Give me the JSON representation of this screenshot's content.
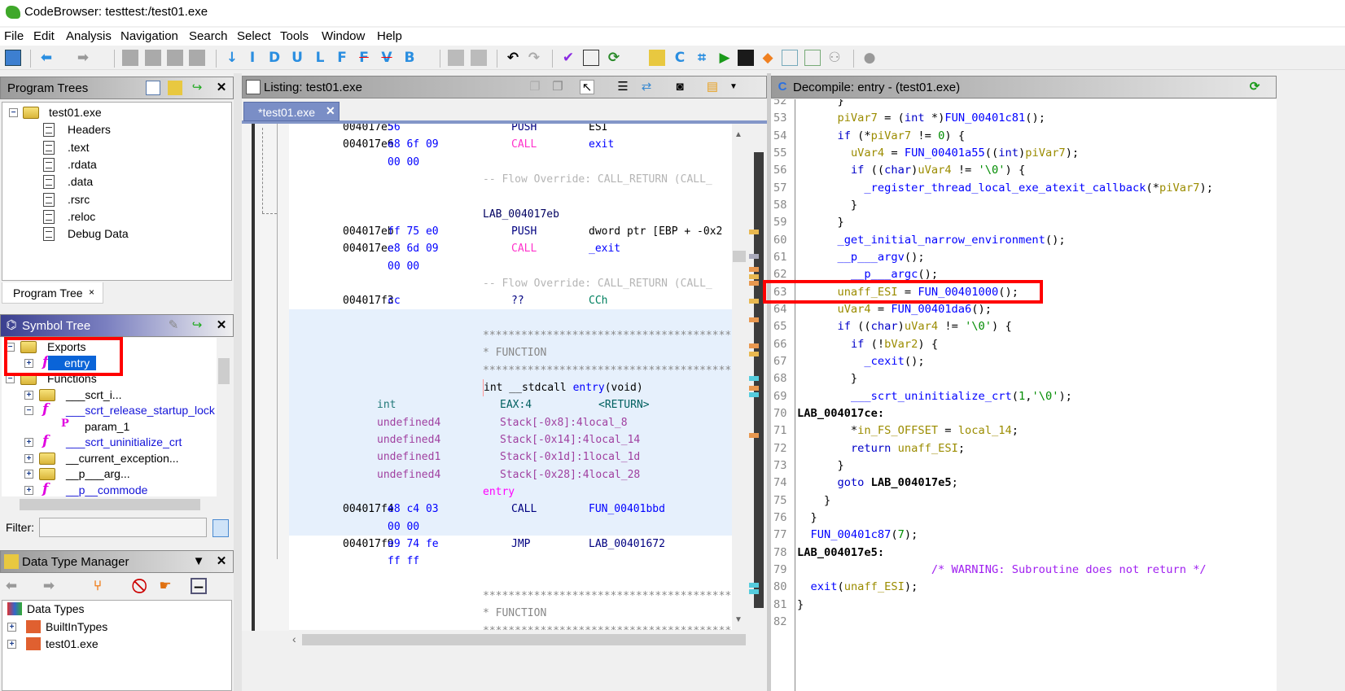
{
  "window": {
    "title": "CodeBrowser: testtest:/test01.exe"
  },
  "menu": [
    "File",
    "Edit",
    "Analysis",
    "Navigation",
    "Search",
    "Select",
    "Tools",
    "Window",
    "Help"
  ],
  "toolbar": {
    "letters": [
      "I",
      "D",
      "U",
      "L",
      "F",
      "F",
      "V",
      "B"
    ]
  },
  "program_trees": {
    "title": "Program Trees",
    "items": [
      {
        "label": "test01.exe",
        "depth": 0
      },
      {
        "label": "Headers",
        "depth": 1
      },
      {
        "label": ".text",
        "depth": 1
      },
      {
        "label": ".rdata",
        "depth": 1
      },
      {
        "label": ".data",
        "depth": 1
      },
      {
        "label": ".rsrc",
        "depth": 1
      },
      {
        "label": ".reloc",
        "depth": 1
      },
      {
        "label": "Debug Data",
        "depth": 1
      }
    ],
    "tab_label": "Program Tree",
    "tab_close": "×"
  },
  "symbol_tree": {
    "title": "Symbol Tree",
    "items": [
      {
        "label": "Exports",
        "depth": 0,
        "icon": "folder",
        "expander": "−"
      },
      {
        "label": "entry",
        "depth": 1,
        "icon": "function",
        "expander": "+",
        "selected": true
      },
      {
        "label": "Functions",
        "depth": 0,
        "icon": "folder",
        "expander": "−"
      },
      {
        "label": "___scrt_i...",
        "depth": 1,
        "icon": "folder",
        "expander": "+"
      },
      {
        "label": "___scrt_release_startup_lock",
        "depth": 1,
        "icon": "function",
        "expander": "−",
        "link": true
      },
      {
        "label": "param_1",
        "depth": 2,
        "icon": "parameter",
        "expander": ""
      },
      {
        "label": "___scrt_uninitialize_crt",
        "depth": 1,
        "icon": "function",
        "expander": "+",
        "link": true
      },
      {
        "label": "__current_exception...",
        "depth": 1,
        "icon": "folder",
        "expander": "+"
      },
      {
        "label": "__p___arg...",
        "depth": 1,
        "icon": "folder",
        "expander": "+"
      },
      {
        "label": "__p__commode",
        "depth": 1,
        "icon": "function",
        "expander": "+",
        "link": true
      }
    ],
    "filter_label": "Filter:",
    "filter_value": ""
  },
  "data_type_manager": {
    "title": "Data Type Manager",
    "items": [
      {
        "label": "Data Types",
        "depth": 0
      },
      {
        "label": "BuiltInTypes",
        "depth": 1
      },
      {
        "label": "test01.exe",
        "depth": 1
      }
    ]
  },
  "listing": {
    "title": "Listing:  test01.exe",
    "tab": "*test01.exe",
    "rows": [
      {
        "type": "ins",
        "addr": "004017e5",
        "bytes": "56",
        "mn": "PUSH",
        "op": "ESI"
      },
      {
        "type": "ins",
        "addr": "004017e6",
        "bytes": "e8 6f 09",
        "mn": "CALL",
        "op": "exit",
        "pink": true
      },
      {
        "type": "ins",
        "addr": "",
        "bytes": "00 00",
        "mn": "",
        "op": ""
      },
      {
        "type": "text",
        "cls": "gray",
        "text": "-- Flow Override: CALL_RETURN (CALL_"
      },
      {
        "type": "blank"
      },
      {
        "type": "text",
        "cls": "lab",
        "text": "LAB_004017eb"
      },
      {
        "type": "ins",
        "addr": "004017eb",
        "bytes": "ff 75 e0",
        "mn": "PUSH",
        "op": "dword ptr [EBP + -0x2"
      },
      {
        "type": "ins",
        "addr": "004017ee",
        "bytes": "e8 6d 09",
        "mn": "CALL",
        "op": "_exit",
        "pink": true
      },
      {
        "type": "ins",
        "addr": "",
        "bytes": "00 00",
        "mn": "",
        "op": ""
      },
      {
        "type": "text",
        "cls": "gray",
        "text": "-- Flow Override: CALL_RETURN (CALL_"
      },
      {
        "type": "ins",
        "addr": "004017f3",
        "bytes": "cc",
        "mn": "??",
        "op": "CCh",
        "opgreen": true
      },
      {
        "type": "blank",
        "hl": true
      },
      {
        "type": "text",
        "cls": "stars",
        "text": "******************************************",
        "hl": true
      },
      {
        "type": "text",
        "cls": "stars",
        "text": "*                             FUNCTION",
        "hl": true
      },
      {
        "type": "text",
        "cls": "stars",
        "text": "******************************************",
        "hl": true
      },
      {
        "type": "sig",
        "text1": "int __stdcall ",
        "text2": "entry",
        "text3": "(void)",
        "hl": true
      },
      {
        "type": "var",
        "dt": "int",
        "loc": "EAX:4",
        "name": "<RETURN>",
        "ret": true,
        "hl": true
      },
      {
        "type": "var",
        "dt": "undefined4",
        "loc": "Stack[-0x8]:4",
        "name": "local_8",
        "hl": true
      },
      {
        "type": "var",
        "dt": "undefined4",
        "loc": "Stack[-0x14]:4",
        "name": "local_14",
        "hl": true
      },
      {
        "type": "var",
        "dt": "undefined1",
        "loc": "Stack[-0x1d]:1",
        "name": "local_1d",
        "hl": true
      },
      {
        "type": "var",
        "dt": "undefined4",
        "loc": "Stack[-0x28]:4",
        "name": "local_28",
        "hl": true
      },
      {
        "type": "text",
        "cls": "entry",
        "text": "entry",
        "hl": true
      },
      {
        "type": "ins",
        "addr": "004017f4",
        "bytes": "e8 c4 03",
        "mn": "CALL",
        "op": "FUN_00401bbd",
        "hl": true
      },
      {
        "type": "ins",
        "addr": "",
        "bytes": "00 00",
        "mn": "",
        "op": "",
        "hl": true
      },
      {
        "type": "ins",
        "addr": "004017f9",
        "bytes": "e9 74 fe",
        "mn": "JMP",
        "op": "LAB_00401672"
      },
      {
        "type": "ins",
        "addr": "",
        "bytes": "ff ff",
        "mn": "",
        "op": ""
      },
      {
        "type": "blank"
      },
      {
        "type": "text",
        "cls": "stars",
        "text": "******************************************"
      },
      {
        "type": "text",
        "cls": "stars",
        "text": "*                             FUNCTION"
      },
      {
        "type": "text",
        "cls": "stars",
        "text": "******************************************"
      }
    ]
  },
  "decompile": {
    "title": "Decompile: entry -  (test01.exe)",
    "lines": [
      {
        "n": "52",
        "t": [
          [
            "      }",
            "p"
          ]
        ]
      },
      {
        "n": "53",
        "t": [
          [
            "      ",
            "p"
          ],
          [
            "piVar7",
            "v"
          ],
          [
            " = (",
            "p"
          ],
          [
            "int",
            "ty"
          ],
          [
            " *)",
            "p"
          ],
          [
            "FUN_00401c81",
            "f"
          ],
          [
            "();",
            "p"
          ]
        ]
      },
      {
        "n": "54",
        "t": [
          [
            "      ",
            "p"
          ],
          [
            "if",
            "k"
          ],
          [
            " (*",
            "p"
          ],
          [
            "piVar7",
            "v"
          ],
          [
            " != ",
            "p"
          ],
          [
            "0",
            "n"
          ],
          [
            ") {",
            "p"
          ]
        ]
      },
      {
        "n": "55",
        "t": [
          [
            "        ",
            "p"
          ],
          [
            "uVar4",
            "v"
          ],
          [
            " = ",
            "p"
          ],
          [
            "FUN_00401a55",
            "f"
          ],
          [
            "((",
            "p"
          ],
          [
            "int",
            "ty"
          ],
          [
            ")",
            "p"
          ],
          [
            "piVar7",
            "v"
          ],
          [
            ");",
            "p"
          ]
        ]
      },
      {
        "n": "56",
        "t": [
          [
            "        ",
            "p"
          ],
          [
            "if",
            "k"
          ],
          [
            " ((",
            "p"
          ],
          [
            "char",
            "ty"
          ],
          [
            ")",
            "p"
          ],
          [
            "uVar4",
            "v"
          ],
          [
            " != ",
            "p"
          ],
          [
            "'\\0'",
            "n"
          ],
          [
            ") {",
            "p"
          ]
        ]
      },
      {
        "n": "57",
        "t": [
          [
            "          ",
            "p"
          ],
          [
            "_register_thread_local_exe_atexit_callback",
            "f"
          ],
          [
            "(*",
            "p"
          ],
          [
            "piVar7",
            "v"
          ],
          [
            ");",
            "p"
          ]
        ]
      },
      {
        "n": "58",
        "t": [
          [
            "        }",
            "p"
          ]
        ]
      },
      {
        "n": "59",
        "t": [
          [
            "      }",
            "p"
          ]
        ]
      },
      {
        "n": "60",
        "t": [
          [
            "      ",
            "p"
          ],
          [
            "_get_initial_narrow_environment",
            "f"
          ],
          [
            "();",
            "p"
          ]
        ]
      },
      {
        "n": "61",
        "t": [
          [
            "      ",
            "p"
          ],
          [
            "__p___argv",
            "f"
          ],
          [
            "();",
            "p"
          ]
        ]
      },
      {
        "n": "62",
        "t": [
          [
            "        ",
            "p"
          ],
          [
            "__p___argc",
            "f"
          ],
          [
            "();",
            "p"
          ]
        ]
      },
      {
        "n": "63",
        "t": [
          [
            "      ",
            "p"
          ],
          [
            "unaff_ESI",
            "v"
          ],
          [
            " = ",
            "p"
          ],
          [
            "FUN_00401000",
            "f"
          ],
          [
            "();",
            "p"
          ]
        ]
      },
      {
        "n": "64",
        "t": [
          [
            "      ",
            "p"
          ],
          [
            "uVar4",
            "v"
          ],
          [
            " = ",
            "p"
          ],
          [
            "FUN_00401da6",
            "f"
          ],
          [
            "();",
            "p"
          ]
        ]
      },
      {
        "n": "65",
        "t": [
          [
            "      ",
            "p"
          ],
          [
            "if",
            "k"
          ],
          [
            " ((",
            "p"
          ],
          [
            "char",
            "ty"
          ],
          [
            ")",
            "p"
          ],
          [
            "uVar4",
            "v"
          ],
          [
            " != ",
            "p"
          ],
          [
            "'\\0'",
            "n"
          ],
          [
            ") {",
            "p"
          ]
        ]
      },
      {
        "n": "66",
        "t": [
          [
            "        ",
            "p"
          ],
          [
            "if",
            "k"
          ],
          [
            " (!",
            "p"
          ],
          [
            "bVar2",
            "v"
          ],
          [
            ") {",
            "p"
          ]
        ]
      },
      {
        "n": "67",
        "t": [
          [
            "          ",
            "p"
          ],
          [
            "_cexit",
            "f"
          ],
          [
            "();",
            "p"
          ]
        ]
      },
      {
        "n": "68",
        "t": [
          [
            "        }",
            "p"
          ]
        ]
      },
      {
        "n": "69",
        "t": [
          [
            "        ",
            "p"
          ],
          [
            "___scrt_uninitialize_crt",
            "f"
          ],
          [
            "(",
            "p"
          ],
          [
            "1",
            "n"
          ],
          [
            ",",
            "p"
          ],
          [
            "'\\0'",
            "n"
          ],
          [
            ");",
            "p"
          ]
        ]
      },
      {
        "n": "70",
        "t": [
          [
            "LAB_004017ce:",
            "lab"
          ]
        ]
      },
      {
        "n": "71",
        "t": [
          [
            "        *",
            "p"
          ],
          [
            "in_FS_OFFSET",
            "v"
          ],
          [
            " = ",
            "p"
          ],
          [
            "local_14",
            "v"
          ],
          [
            ";",
            "p"
          ]
        ]
      },
      {
        "n": "72",
        "t": [
          [
            "        ",
            "p"
          ],
          [
            "return",
            "k"
          ],
          [
            " ",
            "p"
          ],
          [
            "unaff_ESI",
            "v"
          ],
          [
            ";",
            "p"
          ]
        ]
      },
      {
        "n": "73",
        "t": [
          [
            "      }",
            "p"
          ]
        ]
      },
      {
        "n": "74",
        "t": [
          [
            "      ",
            "p"
          ],
          [
            "goto",
            "k"
          ],
          [
            " ",
            "p"
          ],
          [
            "LAB_004017e5",
            "lab"
          ],
          [
            ";",
            "p"
          ]
        ]
      },
      {
        "n": "75",
        "t": [
          [
            "    }",
            "p"
          ]
        ]
      },
      {
        "n": "76",
        "t": [
          [
            "  }",
            "p"
          ]
        ]
      },
      {
        "n": "77",
        "t": [
          [
            "  ",
            "p"
          ],
          [
            "FUN_00401c87",
            "f"
          ],
          [
            "(",
            "p"
          ],
          [
            "7",
            "n"
          ],
          [
            ");",
            "p"
          ]
        ]
      },
      {
        "n": "78",
        "t": [
          [
            "LAB_004017e5:",
            "lab"
          ]
        ]
      },
      {
        "n": "79",
        "t": [
          [
            "                    ",
            "p"
          ],
          [
            "/* WARNING: Subroutine does not return */",
            "cm"
          ]
        ]
      },
      {
        "n": "80",
        "t": [
          [
            "  ",
            "p"
          ],
          [
            "exit",
            "f"
          ],
          [
            "(",
            "p"
          ],
          [
            "unaff_ESI",
            "v"
          ],
          [
            ");",
            "p"
          ]
        ]
      },
      {
        "n": "81",
        "t": [
          [
            "}",
            "p"
          ]
        ]
      },
      {
        "n": "82",
        "t": [
          [
            "",
            "p"
          ]
        ]
      }
    ]
  },
  "colors": {
    "highlight": "#e6f0fc",
    "selection": "#0a64d8",
    "annotation": "#ff0000"
  }
}
